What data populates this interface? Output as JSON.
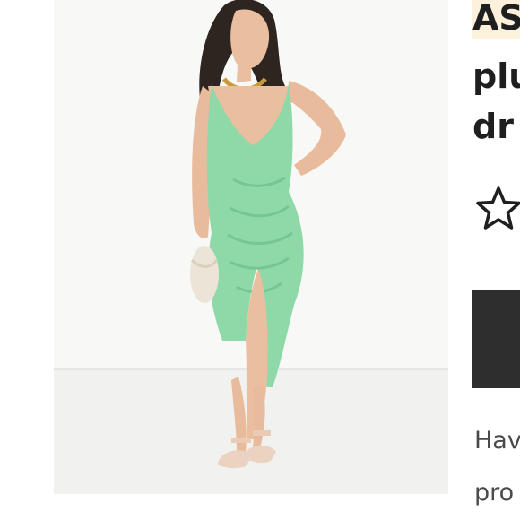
{
  "product": {
    "title_lines": [
      "AS",
      "plu",
      "dr"
    ],
    "image_alt": "Model wearing a mint green plunge midi dress with ruched front split",
    "colors": {
      "dress": "#8fd9a8",
      "brand_highlight": "#fdf1db",
      "button": "#2e2e2e"
    }
  },
  "rating": {
    "icon": "star-outline-icon"
  },
  "description": {
    "lines": [
      "Hav",
      "pro"
    ]
  }
}
